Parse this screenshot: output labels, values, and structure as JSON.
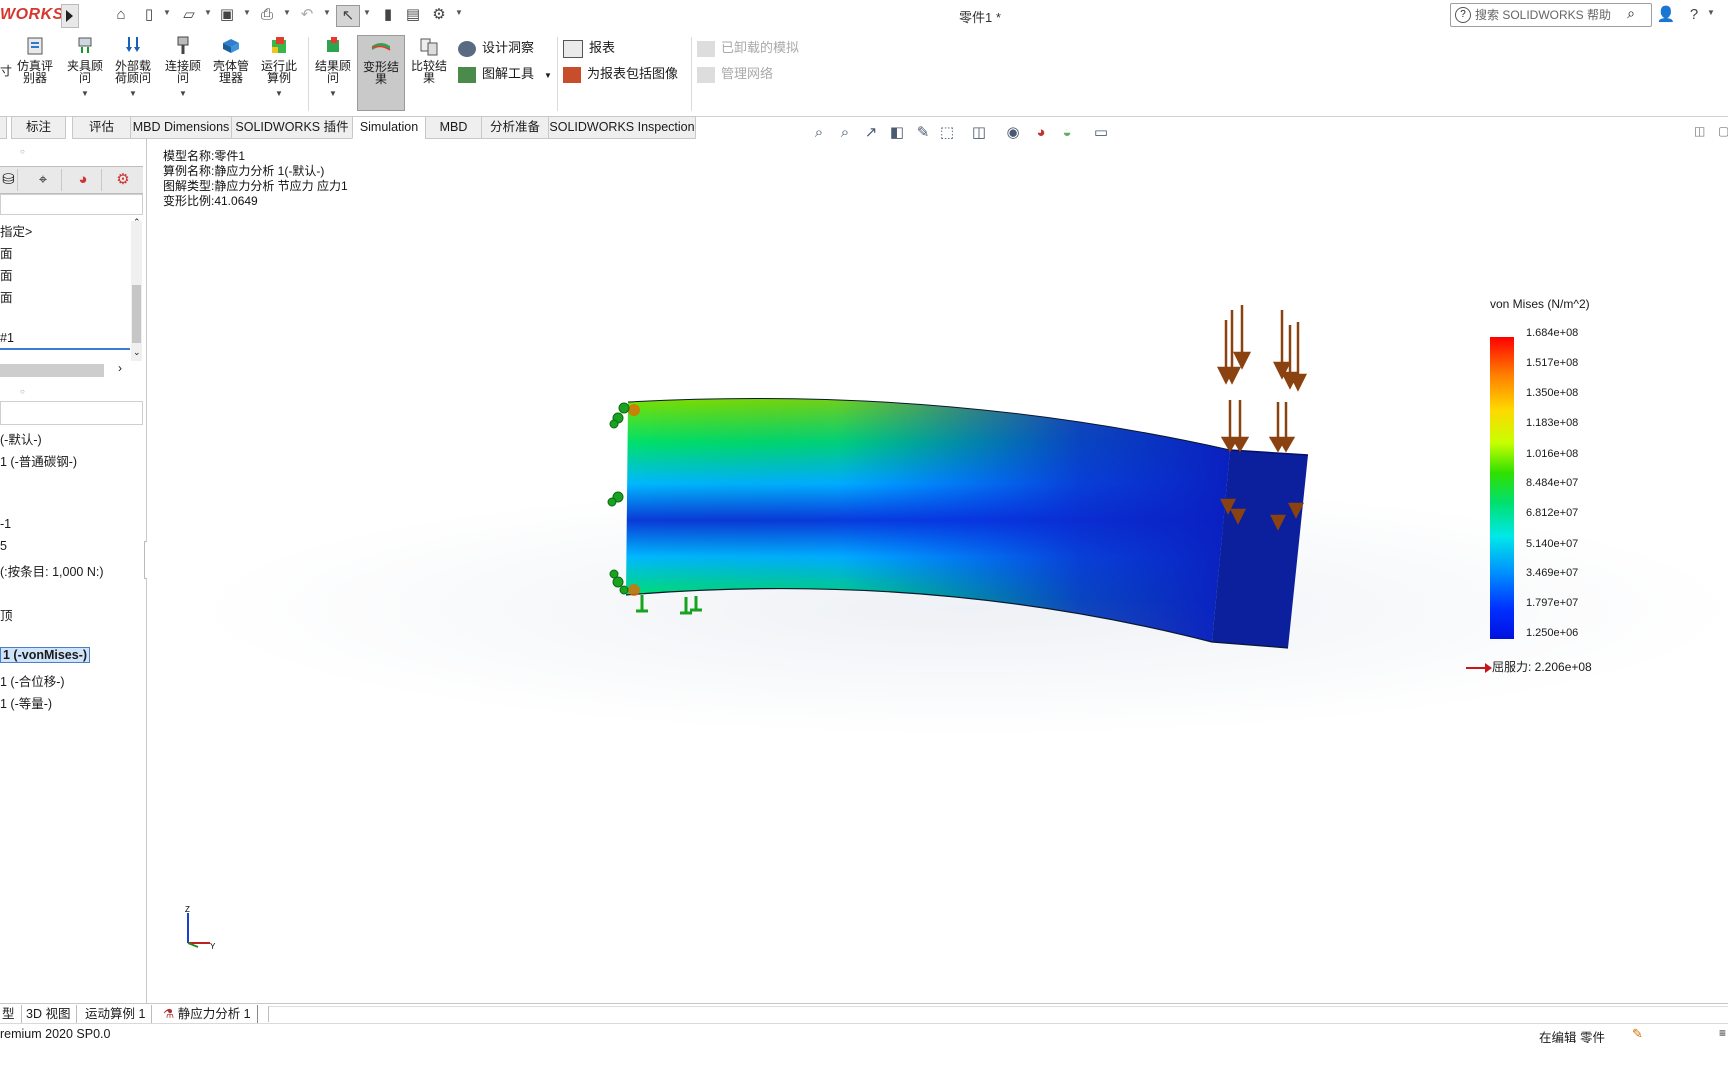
{
  "app": {
    "logo_text": "WORKS",
    "document_title": "零件1 *"
  },
  "search": {
    "placeholder": "搜索 SOLIDWORKS 帮助"
  },
  "commands": {
    "big": [
      {
        "label": "仿真评\n别器"
      },
      {
        "label": "夹具顾\n问"
      },
      {
        "label": "外部载\n荷顾问"
      },
      {
        "label": "连接顾\n问"
      },
      {
        "label": "壳体管\n理器"
      },
      {
        "label": "运行此\n算例"
      },
      {
        "label": "结果顾\n问"
      },
      {
        "label": "变形结\n果"
      },
      {
        "label": "比较结\n果"
      }
    ],
    "small": {
      "design_insight": "设计洞察",
      "plot_tools": "图解工具",
      "report": "报表",
      "include_image": "为报表包括图像",
      "unloaded_study": "已卸载的模拟",
      "manage_network": "管理网络"
    }
  },
  "tabs": [
    "标注",
    "评估",
    "MBD Dimensions",
    "SOLIDWORKS 插件",
    "Simulation",
    "MBD",
    "分析准备",
    "SOLIDWORKS Inspection"
  ],
  "left_panel": {
    "tree_top": [
      "指定>",
      "面",
      "面",
      "面",
      "#1"
    ],
    "tree_bottom": [
      " (-默认-)",
      "1 (-普通碳钢-)",
      "-1",
      "5",
      " (:按条目: 1,000 N:)",
      "顶",
      "1 (-vonMises-)",
      "1 (-合位移-)",
      "1 (-等量-)"
    ]
  },
  "plot_info": {
    "model_name": "模型名称:零件1",
    "study_name": "算例名称:静应力分析 1(-默认-)",
    "plot_type": "图解类型:静应力分析 节应力 应力1",
    "deform_scale": "变形比例:41.0649"
  },
  "legend": {
    "title": "von Mises (N/m^2)",
    "ticks": [
      "1.684e+08",
      "1.517e+08",
      "1.350e+08",
      "1.183e+08",
      "1.016e+08",
      "8.484e+07",
      "6.812e+07",
      "5.140e+07",
      "3.469e+07",
      "1.797e+07",
      "1.250e+06"
    ],
    "yield": "屈服力: 2.206e+08"
  },
  "bottom_tabs": [
    "型",
    "3D 视图",
    "运动算例 1",
    "静应力分析 1"
  ],
  "status": {
    "left": "remium 2020 SP0.0",
    "editing": "在编辑 零件"
  },
  "triad": {
    "z": "Z",
    "y": "Y"
  }
}
